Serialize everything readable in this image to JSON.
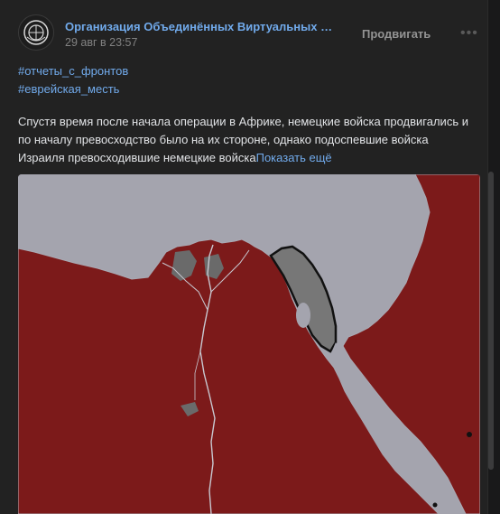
{
  "post": {
    "author": "Организация Объединённых Виртуальных Государств",
    "date": "29 авг в 23:57",
    "promote_label": "Продвигать",
    "more_label": "•••",
    "tags": [
      "#отчеты_с_фронтов",
      "#еврейская_месть"
    ],
    "text_lines": [
      "Спустя время после начала операции в Африке, немецкие войска продвигались и",
      "по началу превосходство было на их стороне, однако подоспевшие войска",
      "Израиля превосходившие немецкие войска"
    ],
    "show_more_label": "Показать ещё"
  },
  "icons": {
    "avatar": "organization-emblem-icon",
    "more": "more-dots-icon"
  },
  "colors": {
    "link": "#71aaeb",
    "territory_red": "#7c1a1a",
    "sea": "#a4a4ae",
    "lakes": "#6a6a6a"
  }
}
